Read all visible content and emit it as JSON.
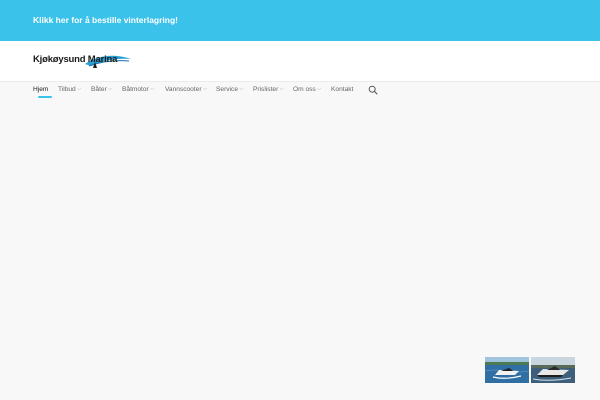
{
  "topbar": {
    "link_label": "Klikk her for å bestille vinterlagring!",
    "background": "#3ac2ea"
  },
  "logo": {
    "text": "Kjøkøysund Marina",
    "swoosh_color": "#2a9fd6"
  },
  "nav": {
    "items": [
      {
        "label": "Hjem",
        "active": true,
        "has_dropdown": false
      },
      {
        "label": "Tilbud",
        "has_dropdown": true
      },
      {
        "label": "Båter",
        "has_dropdown": true
      },
      {
        "label": "Båtmotor",
        "has_dropdown": true
      },
      {
        "label": "Vannscooter",
        "has_dropdown": true
      },
      {
        "label": "Service",
        "has_dropdown": true
      },
      {
        "label": "Prislister",
        "has_dropdown": true
      },
      {
        "label": "Om oss",
        "has_dropdown": true
      },
      {
        "label": "Kontakt",
        "has_dropdown": false
      }
    ],
    "accent": "#3ac2ea",
    "search_icon": "search-icon",
    "dropdown_icon": "chevron-down-icon"
  },
  "slider": {
    "thumbnails": [
      {
        "name": "boat-thumbnail-1"
      },
      {
        "name": "boat-thumbnail-2"
      }
    ]
  }
}
